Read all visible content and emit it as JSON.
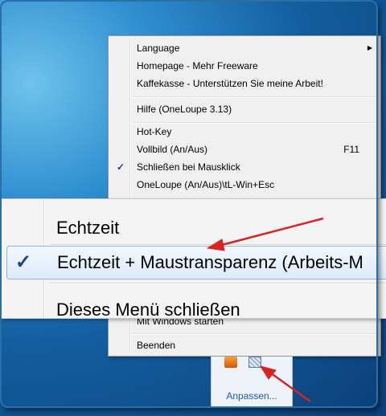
{
  "menu": {
    "items": [
      {
        "label": "Language",
        "submenu": true
      },
      {
        "label": "Homepage - Mehr Freeware"
      },
      {
        "label": "Kaffekasse - Unterstützen Sie meine Arbeit!"
      },
      {
        "label": "Hilfe (OneLoupe 3.13)"
      },
      {
        "label": "Hot-Key"
      },
      {
        "label": "Vollbild (An/Aus)",
        "shortcut": "F11"
      },
      {
        "label": "Schließen bei Mausklick",
        "checked": true
      },
      {
        "label": "OneLoupe (An/Aus)\\tL-Win+Esc"
      },
      {
        "label": "Mit Windows starten"
      },
      {
        "label": "Beenden"
      }
    ],
    "check_glyph": "✓",
    "submenu_glyph": "▶"
  },
  "zoom": {
    "items": [
      {
        "label": "Echtzeit"
      },
      {
        "label": "Echtzeit + Maustransparenz (Arbeits-M",
        "checked": true,
        "highlighted": true
      },
      {
        "label": "Dieses Menü schließen"
      }
    ]
  },
  "tray": {
    "icons": [
      "app-orange-icon",
      "oneloupe-tray-icon"
    ],
    "link": "Anpassen..."
  },
  "colors": {
    "desktop": "#135e9f",
    "menu_bg": "#f0f0f0",
    "arrow": "#d8231f",
    "link": "#1e5bb8"
  }
}
